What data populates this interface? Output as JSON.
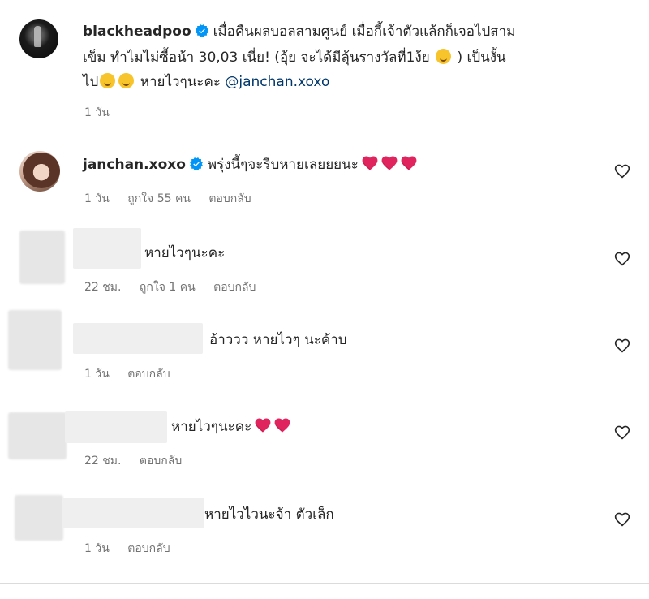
{
  "post": {
    "username": "blackheadpoo",
    "caption_line1": "เมื่อคืนผลบอลสามศูนย์ เมื่อกี้เจ้าตัวแล้กก็เจอไปสาม",
    "caption_line2a": "เข็ม ทำไมไม่ซื้อน้า 30,03 เนี่ย! (อุ้ย จะได้มีลุ้นรางวัลที่1ง้ย",
    "caption_line2b": ") เป็นงั้น",
    "caption_line3a": "ไป",
    "caption_line3b": "หายไวๆนะคะ",
    "mention": "@janchan.xoxo",
    "time": "1 วัน"
  },
  "comments": [
    {
      "username": "janchan.xoxo",
      "text": "พรุ่งนี้ๆจะรีบหายเลยยยนะ",
      "time": "1 วัน",
      "likes": "ถูกใจ 55 คน",
      "reply": "ตอบกลับ"
    },
    {
      "text": "หายไวๆนะคะ",
      "time": "22 ชม.",
      "likes": "ถูกใจ 1 คน",
      "reply": "ตอบกลับ"
    },
    {
      "text": "อ้าววว หายไวๆ นะค้าบ",
      "time": "1 วัน",
      "reply": "ตอบกลับ"
    },
    {
      "text": "หายไวๆนะคะ",
      "time": "22 ชม.",
      "reply": "ตอบกลับ"
    },
    {
      "text": "หายไวไวนะจ้า ตัวเล็ก",
      "time": "1 วัน",
      "reply": "ตอบกลับ"
    }
  ],
  "icons": {
    "verified": "verified-badge-icon",
    "like": "heart-outline-icon",
    "heart_emoji": "red-heart-emoji",
    "laugh_emoji": "rofl-emoji",
    "sweat_emoji": "sweat-smile-emoji"
  },
  "colors": {
    "verified": "#0095f6",
    "heart": "#e0245e",
    "text": "#262626",
    "meta": "#737373",
    "mention": "#00376b"
  }
}
